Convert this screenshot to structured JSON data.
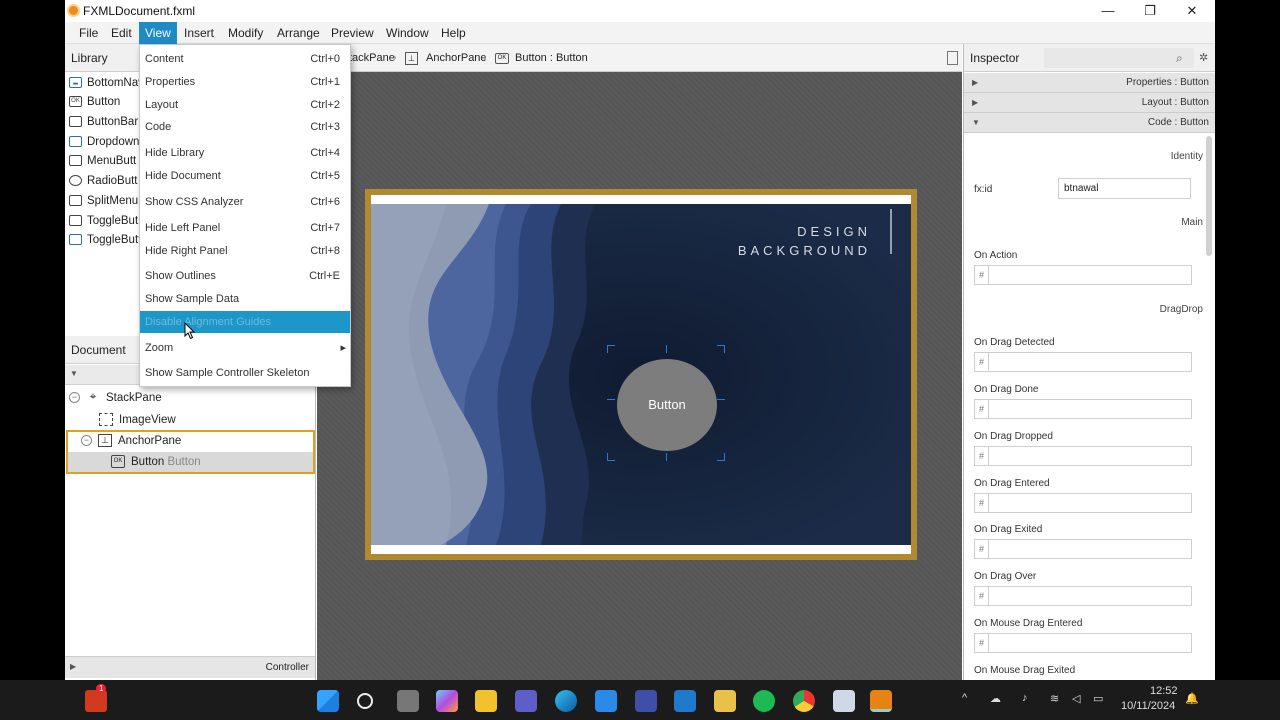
{
  "window": {
    "title": "FXMLDocument.fxml",
    "controls": [
      "—",
      "❐",
      "✕"
    ]
  },
  "menubar": [
    "File",
    "Edit",
    "View",
    "Insert",
    "Modify",
    "Arrange",
    "Preview",
    "Window",
    "Help"
  ],
  "library": {
    "header": "Library",
    "items": [
      "BottomNav",
      "Button",
      "ButtonBar",
      "Dropdown",
      "MenuButt",
      "RadioButt",
      "SplitMenu",
      "ToggleBut",
      "ToggleButt"
    ]
  },
  "document": {
    "header": "Document",
    "tree": [
      {
        "label": "StackPane",
        "sub": ""
      },
      {
        "label": "ImageView",
        "sub": ""
      },
      {
        "label": "AnchorPane",
        "sub": ""
      },
      {
        "label": "Button",
        "sub": "Button"
      }
    ],
    "footer": "Controller"
  },
  "breadcrumb": [
    "tackPane",
    "AnchorPane",
    "Button : Button"
  ],
  "canvas": {
    "heading_line1": "DESIGN",
    "heading_line2": "BACKGROUND",
    "button_text": "Button"
  },
  "view_menu": [
    {
      "label": "Content",
      "shortcut": "Ctrl+0"
    },
    {
      "label": "Properties",
      "shortcut": "Ctrl+1"
    },
    {
      "label": "Layout",
      "shortcut": "Ctrl+2"
    },
    {
      "label": "Code",
      "shortcut": "Ctrl+3"
    },
    {
      "label": "Hide Library",
      "shortcut": "Ctrl+4"
    },
    {
      "label": "Hide Document",
      "shortcut": "Ctrl+5"
    },
    {
      "label": "Show CSS Analyzer",
      "shortcut": "Ctrl+6"
    },
    {
      "label": "Hide Left Panel",
      "shortcut": "Ctrl+7"
    },
    {
      "label": "Hide Right Panel",
      "shortcut": "Ctrl+8"
    },
    {
      "label": "Show Outlines",
      "shortcut": "Ctrl+E"
    },
    {
      "label": "Show Sample Data",
      "shortcut": ""
    },
    {
      "label": "Disable Alignment Guides",
      "shortcut": ""
    },
    {
      "label": "Zoom",
      "shortcut": "▸"
    },
    {
      "label": "Show Sample Controller Skeleton",
      "shortcut": ""
    }
  ],
  "inspector": {
    "header": "Inspector",
    "sections": [
      "Properties : Button",
      "Layout : Button",
      "Code : Button"
    ],
    "identity_label": "Identity",
    "fxid_label": "fx:id",
    "fxid_value": "btnawal",
    "main_label": "Main",
    "dragdrop_label": "DragDrop",
    "events": [
      "On Action",
      "On Drag Detected",
      "On Drag Done",
      "On Drag Dropped",
      "On Drag Entered",
      "On Drag Exited",
      "On Drag Over",
      "On Mouse Drag Entered",
      "On Mouse Drag Exited"
    ],
    "hash": "#"
  },
  "taskbar": {
    "time": "12:52",
    "date": "10/11/2024",
    "badge": "1"
  }
}
